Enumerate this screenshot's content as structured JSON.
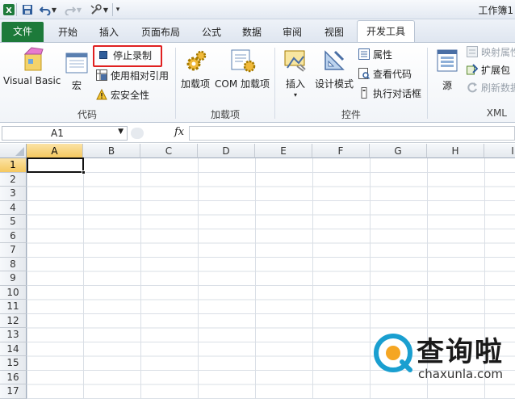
{
  "colors": {
    "file_tab": "#1d7a3a",
    "highlight_box": "#e02020",
    "selected_header": "#f5c85f"
  },
  "titlebar": {
    "title": "工作簿1"
  },
  "tabs": [
    "文件",
    "开始",
    "插入",
    "页面布局",
    "公式",
    "数据",
    "审阅",
    "视图",
    "开发工具"
  ],
  "ribbon": {
    "code_group": {
      "label": "代码",
      "visual_basic": "Visual Basic",
      "macros": "宏",
      "stop_recording": "停止录制",
      "relative_ref": "使用相对引用",
      "macro_security": "宏安全性"
    },
    "addins_group": {
      "label": "加载项",
      "addins": "加载项",
      "com_addins": "COM 加载项"
    },
    "controls_group": {
      "label": "控件",
      "insert": "插入",
      "design_mode": "设计模式",
      "properties": "属性",
      "view_code": "查看代码",
      "run_dialog": "执行对话框"
    },
    "xml_group": {
      "label": "XML",
      "source": "源",
      "map_properties": "映射属性",
      "expansion_packs": "扩展包",
      "refresh_data": "刷新数据"
    }
  },
  "formula_bar": {
    "name_box": "A1",
    "fx": "fx",
    "formula": ""
  },
  "grid": {
    "columns": [
      "A",
      "B",
      "C",
      "D",
      "E",
      "F",
      "G",
      "H",
      "I"
    ],
    "rows": [
      "1",
      "2",
      "3",
      "4",
      "5",
      "6",
      "7",
      "8",
      "9",
      "10",
      "11",
      "12",
      "13",
      "14",
      "15",
      "16",
      "17"
    ],
    "selected_cell": "A1"
  },
  "watermark": {
    "brand": "查询啦",
    "url": "chaxunla.com"
  }
}
